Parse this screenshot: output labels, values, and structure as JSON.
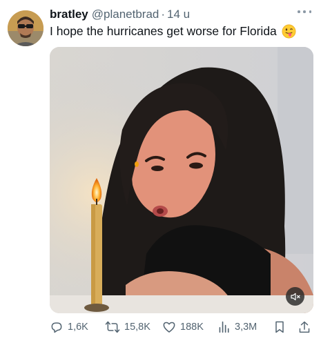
{
  "tweet": {
    "author_name": "bratley",
    "handle": "@planetbrad",
    "separator": "·",
    "time": "14 u",
    "text": "I hope the hurricanes get worse for Florida",
    "emoji": "face-with-tongue"
  },
  "media": {
    "type": "video",
    "muted": true,
    "mute_icon": "speaker-muted-icon"
  },
  "actions": {
    "replies": "1,6K",
    "reposts": "15,8K",
    "likes": "188K",
    "views": "3,3M"
  },
  "colors": {
    "text": "#0f1419",
    "secondary": "#536471",
    "background": "#ffffff"
  }
}
